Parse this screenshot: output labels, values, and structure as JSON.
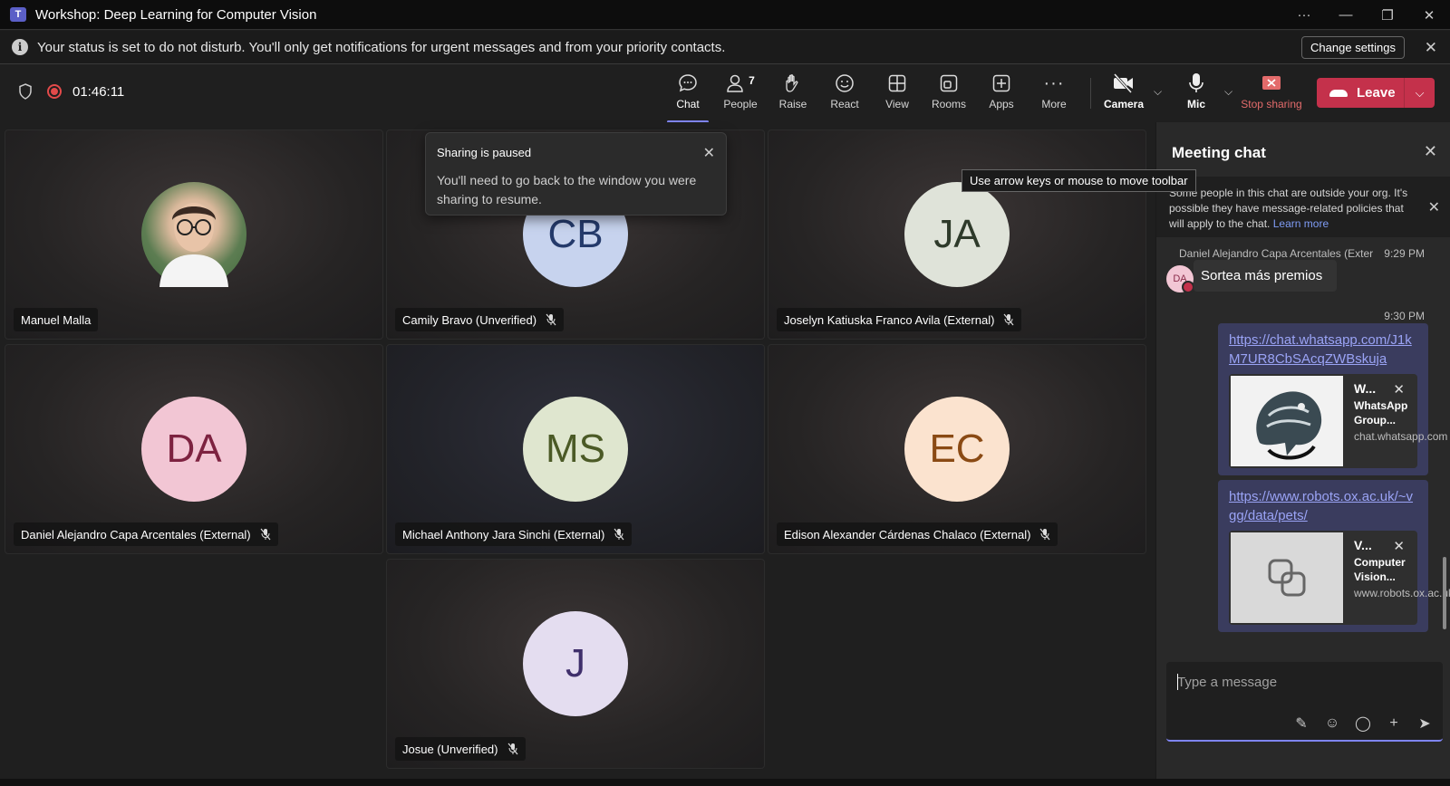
{
  "window": {
    "title": "Workshop: Deep Learning for Computer Vision"
  },
  "banner": {
    "message": "Your status is set to do not disturb. You'll only get notifications for urgent messages and from your priority contacts.",
    "button": "Change settings"
  },
  "toolbar": {
    "timer": "01:46:11",
    "buttons": [
      {
        "label": "Chat",
        "icon": "chat-icon"
      },
      {
        "label": "People",
        "icon": "people-icon",
        "badge": "7"
      },
      {
        "label": "Raise",
        "icon": "hand-icon"
      },
      {
        "label": "React",
        "icon": "smiley-icon"
      },
      {
        "label": "View",
        "icon": "grid-icon"
      },
      {
        "label": "Rooms",
        "icon": "rooms-icon"
      },
      {
        "label": "Apps",
        "icon": "plus-box-icon"
      },
      {
        "label": "More",
        "icon": "ellipsis-icon"
      },
      {
        "label": "Camera",
        "icon": "camera-off-icon"
      },
      {
        "label": "Mic",
        "icon": "mic-icon"
      },
      {
        "label": "Stop sharing",
        "icon": "stop-share-icon"
      }
    ],
    "leave": "Leave"
  },
  "participants": [
    {
      "name": "Manuel Malla",
      "initials": "",
      "muted": false
    },
    {
      "name": "Camily Bravo (Unverified)",
      "initials": "CB",
      "muted": true,
      "bg": "#c7d3ee",
      "fg": "#243a6b"
    },
    {
      "name": "Joselyn Katiuska Franco Avila (External)",
      "initials": "JA",
      "muted": true,
      "bg": "#dfe3d9",
      "fg": "#2e3a2a"
    },
    {
      "name": "Daniel Alejandro Capa Arcentales (External)",
      "initials": "DA",
      "muted": true,
      "bg": "#f2c6d4",
      "fg": "#7d2240"
    },
    {
      "name": "Michael Anthony Jara Sinchi (External)",
      "initials": "MS",
      "muted": true,
      "bg": "#dfe6cf",
      "fg": "#4b5a26"
    },
    {
      "name": "Edison Alexander Cárdenas Chalaco (External)",
      "initials": "EC",
      "muted": true,
      "bg": "#fbe3cf",
      "fg": "#8a4a14"
    },
    {
      "name": "Josue (Unverified)",
      "initials": "J",
      "muted": true,
      "bg": "#e4ddf0",
      "fg": "#3f2f6b"
    }
  ],
  "toast": {
    "title": "Sharing is paused",
    "body": "You'll need to go back to the window you were sharing to resume."
  },
  "tooltip": "Use arrow keys or mouse to move toolbar",
  "chat": {
    "title": "Meeting chat",
    "notice": "Some people in this chat are outside your org. It's possible they have message-related policies that will apply to the chat.",
    "notice_link": "Learn more",
    "sender": "Daniel Alejandro Capa Arcentales (Exter",
    "sender_time": "9:29 PM",
    "sender_initials": "DA",
    "message": "Sortea más premios",
    "my_time": "9:30 PM",
    "links": [
      {
        "url": "https://chat.whatsapp.com/J1kM7UR8CbSAcqZWBskuja",
        "card_title": "W...",
        "card_sub": "WhatsApp Group...",
        "card_domain": "chat.whatsapp.com"
      },
      {
        "url": "https://www.robots.ox.ac.uk/~vgg/data/pets/",
        "card_title": "V...",
        "card_sub": "Computer Vision...",
        "card_domain": "www.robots.ox.ac.uk"
      }
    ],
    "compose_placeholder": "Type a message"
  }
}
